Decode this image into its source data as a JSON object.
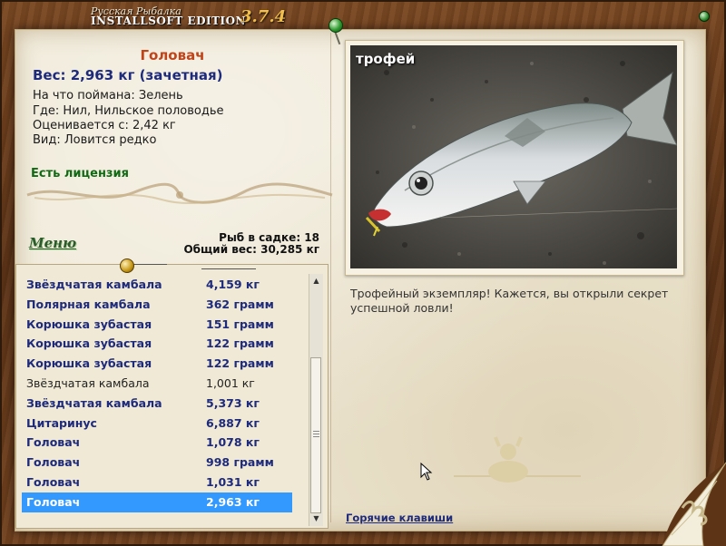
{
  "window": {
    "title_small": "Русская Рыбалка",
    "title_main": "INSTALLSOFT EDITION",
    "version": "3.7.4"
  },
  "catch": {
    "name": "Головач",
    "weight_line": "Вес: 2,963 кг (зачетная)",
    "bait_line": "На что поймана: Зелень",
    "place_line": "Где: Нил, Нильское половодье",
    "valued_line": "Оценивается с: 2,42 кг",
    "kind_line": "Вид: Ловится редко",
    "license": "Есть лицензия"
  },
  "menu": {
    "label": "Меню"
  },
  "keepnet": {
    "count_line": "Рыб в садке: 18",
    "total_line": "Общий вес: 30,285 кг"
  },
  "catch_list": [
    {
      "name": "Звёздчатая камбала",
      "weight": "4,159 кг",
      "style": "bold"
    },
    {
      "name": "Полярная камбала",
      "weight": "362 грамм",
      "style": "bold"
    },
    {
      "name": "Корюшка зубастая",
      "weight": "151 грамм",
      "style": "bold"
    },
    {
      "name": "Корюшка зубастая",
      "weight": "122 грамм",
      "style": "bold"
    },
    {
      "name": "Корюшка зубастая",
      "weight": "122 грамм",
      "style": "bold"
    },
    {
      "name": "Звёздчатая камбала",
      "weight": "1,001 кг",
      "style": "normal"
    },
    {
      "name": "Звёздчатая камбала",
      "weight": "5,373 кг",
      "style": "bold"
    },
    {
      "name": "Цитаринус",
      "weight": "6,887 кг",
      "style": "bold"
    },
    {
      "name": "Головач",
      "weight": "1,078 кг",
      "style": "bold"
    },
    {
      "name": "Головач",
      "weight": "998 грамм",
      "style": "bold"
    },
    {
      "name": "Головач",
      "weight": "1,031 кг",
      "style": "bold"
    },
    {
      "name": "Головач",
      "weight": "2,963 кг",
      "style": "selected"
    }
  ],
  "photo": {
    "label": "трофей"
  },
  "description": "Трофейный экземпляр! Кажется, вы открыли секрет успешной ловли!",
  "hotkeys": {
    "label": "Горячие клавиши"
  },
  "colors": {
    "fish_name": "#c0441a",
    "accent_blue": "#1e2a7c",
    "license_green": "#106a14",
    "selection": "#3399ff"
  }
}
